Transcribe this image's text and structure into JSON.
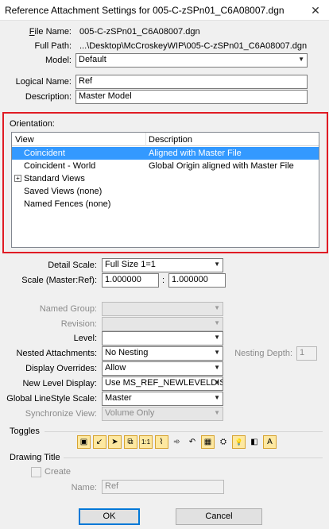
{
  "window": {
    "title": "Reference Attachment Settings for 005-C-zSPn01_C6A08007.dgn",
    "close_glyph": "✕"
  },
  "file": {
    "file_name_label": "File Name:",
    "file_name": "005-C-zSPn01_C6A08007.dgn",
    "full_path_label": "Full Path:",
    "full_path": "...\\Desktop\\McCroskeyWIP\\005-C-zSPn01_C6A08007.dgn",
    "model_label": "Model:",
    "model": "Default"
  },
  "logical": {
    "logical_name_label": "Logical Name:",
    "logical_name": "Ref",
    "description_label": "Description:",
    "description": "Master Model"
  },
  "orientation": {
    "label": "Orientation:",
    "columns": [
      "View",
      "Description"
    ],
    "rows": [
      {
        "view": "Coincident",
        "description": "Aligned with Master File",
        "selected": true
      },
      {
        "view": "Coincident - World",
        "description": "Global Origin aligned with Master File"
      },
      {
        "view": "Standard Views",
        "description": "",
        "expander": "+"
      },
      {
        "view": "Saved Views (none)",
        "description": ""
      },
      {
        "view": "Named Fences (none)",
        "description": ""
      }
    ]
  },
  "scale": {
    "detail_scale_label": "Detail Scale:",
    "detail_scale": "Full Size 1=1",
    "scale_label": "Scale (Master:Ref):",
    "master": "1.000000",
    "separator": ":",
    "ref": "1.000000"
  },
  "fields": {
    "named_group_label": "Named Group:",
    "named_group": "",
    "revision_label": "Revision:",
    "revision": "",
    "level_label": "Level:",
    "level": "",
    "nested_label": "Nested Attachments:",
    "nested": "No Nesting",
    "nesting_depth_label": "Nesting Depth:",
    "nesting_depth": "1",
    "display_overrides_label": "Display Overrides:",
    "display_overrides": "Allow",
    "new_level_label": "New Level Display:",
    "new_level": "Use MS_REF_NEWLEVELDIS",
    "linestyle_label": "Global LineStyle Scale:",
    "linestyle": "Master",
    "sync_label": "Synchronize View:",
    "sync": "Volume Only"
  },
  "toggles": {
    "label": "Toggles",
    "tools": [
      {
        "name": "display-toggle-icon",
        "glyph": "▣",
        "on": true
      },
      {
        "name": "snap-toggle-icon",
        "glyph": "↙",
        "on": true
      },
      {
        "name": "locate-toggle-icon",
        "glyph": "➤",
        "on": true
      },
      {
        "name": "hide-toggle-icon",
        "glyph": "⧉",
        "on": true
      },
      {
        "name": "scale-line-styles-icon",
        "glyph": "1:1",
        "on": true
      },
      {
        "name": "treat-as-element-icon",
        "glyph": "⌇",
        "on": true
      },
      {
        "name": "ignore-attachment-icon",
        "glyph": "➾",
        "on": false
      },
      {
        "name": "display-raster-icon",
        "glyph": "↶",
        "on": false
      },
      {
        "name": "level-display-icon",
        "glyph": "▦",
        "on": true
      },
      {
        "name": "georeference-icon",
        "glyph": "⛭",
        "on": false
      },
      {
        "name": "light-bulb-icon",
        "glyph": "💡",
        "on": true
      },
      {
        "name": "clip-back-icon",
        "glyph": "◧",
        "on": false
      },
      {
        "name": "annotation-scale-icon",
        "glyph": "A",
        "on": true
      }
    ]
  },
  "drawing_title": {
    "label": "Drawing Title",
    "create_label": "Create",
    "name_label": "Name:",
    "name_value": "Ref"
  },
  "buttons": {
    "ok": "OK",
    "cancel": "Cancel"
  },
  "colors": {
    "highlight": "#3399ff",
    "annotation_red": "#e01b24"
  }
}
